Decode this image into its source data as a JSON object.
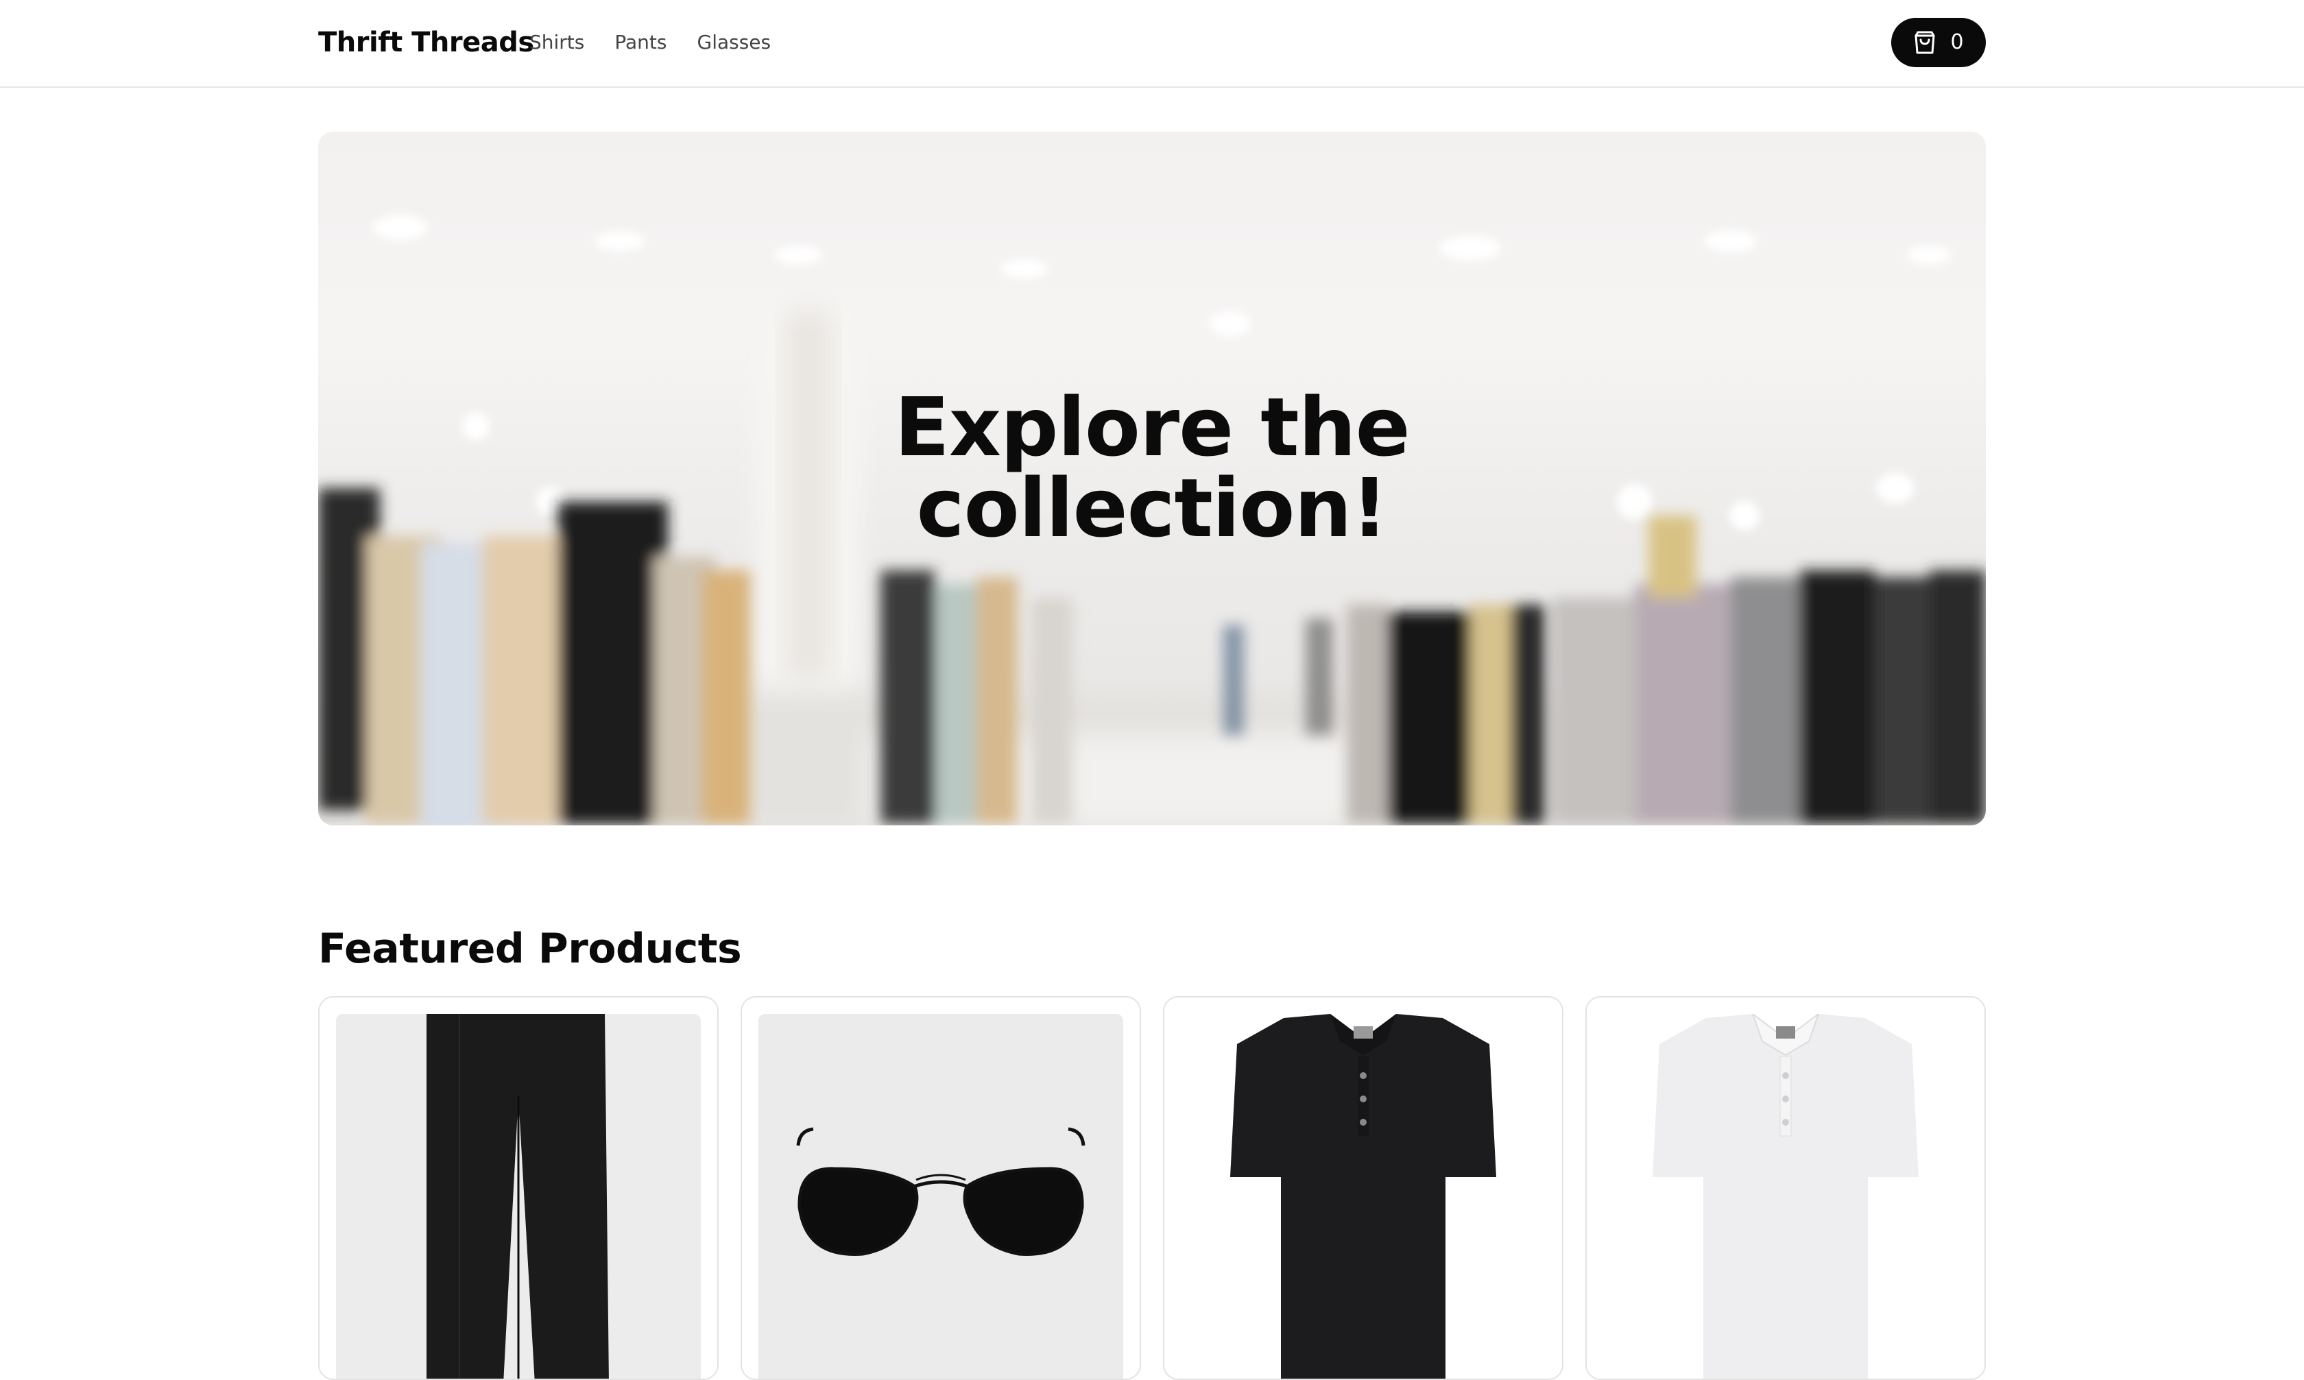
{
  "header": {
    "brand": "Thrift Threads",
    "nav": [
      "Shirts",
      "Pants",
      "Glasses"
    ],
    "cart": {
      "icon": "shopping-bag-icon",
      "count": "0"
    }
  },
  "hero": {
    "title_line1": "Explore the",
    "title_line2": "collection!",
    "background": "blurred clothing store interior"
  },
  "featured": {
    "title": "Featured Products",
    "products": [
      {
        "image": "black-pants"
      },
      {
        "image": "aviator-sunglasses"
      },
      {
        "image": "black-polo-shirt"
      },
      {
        "image": "white-polo-shirt"
      }
    ]
  },
  "colors": {
    "accent": "#0a0a0a",
    "border": "#e3e3e3",
    "text_muted": "#444444"
  }
}
